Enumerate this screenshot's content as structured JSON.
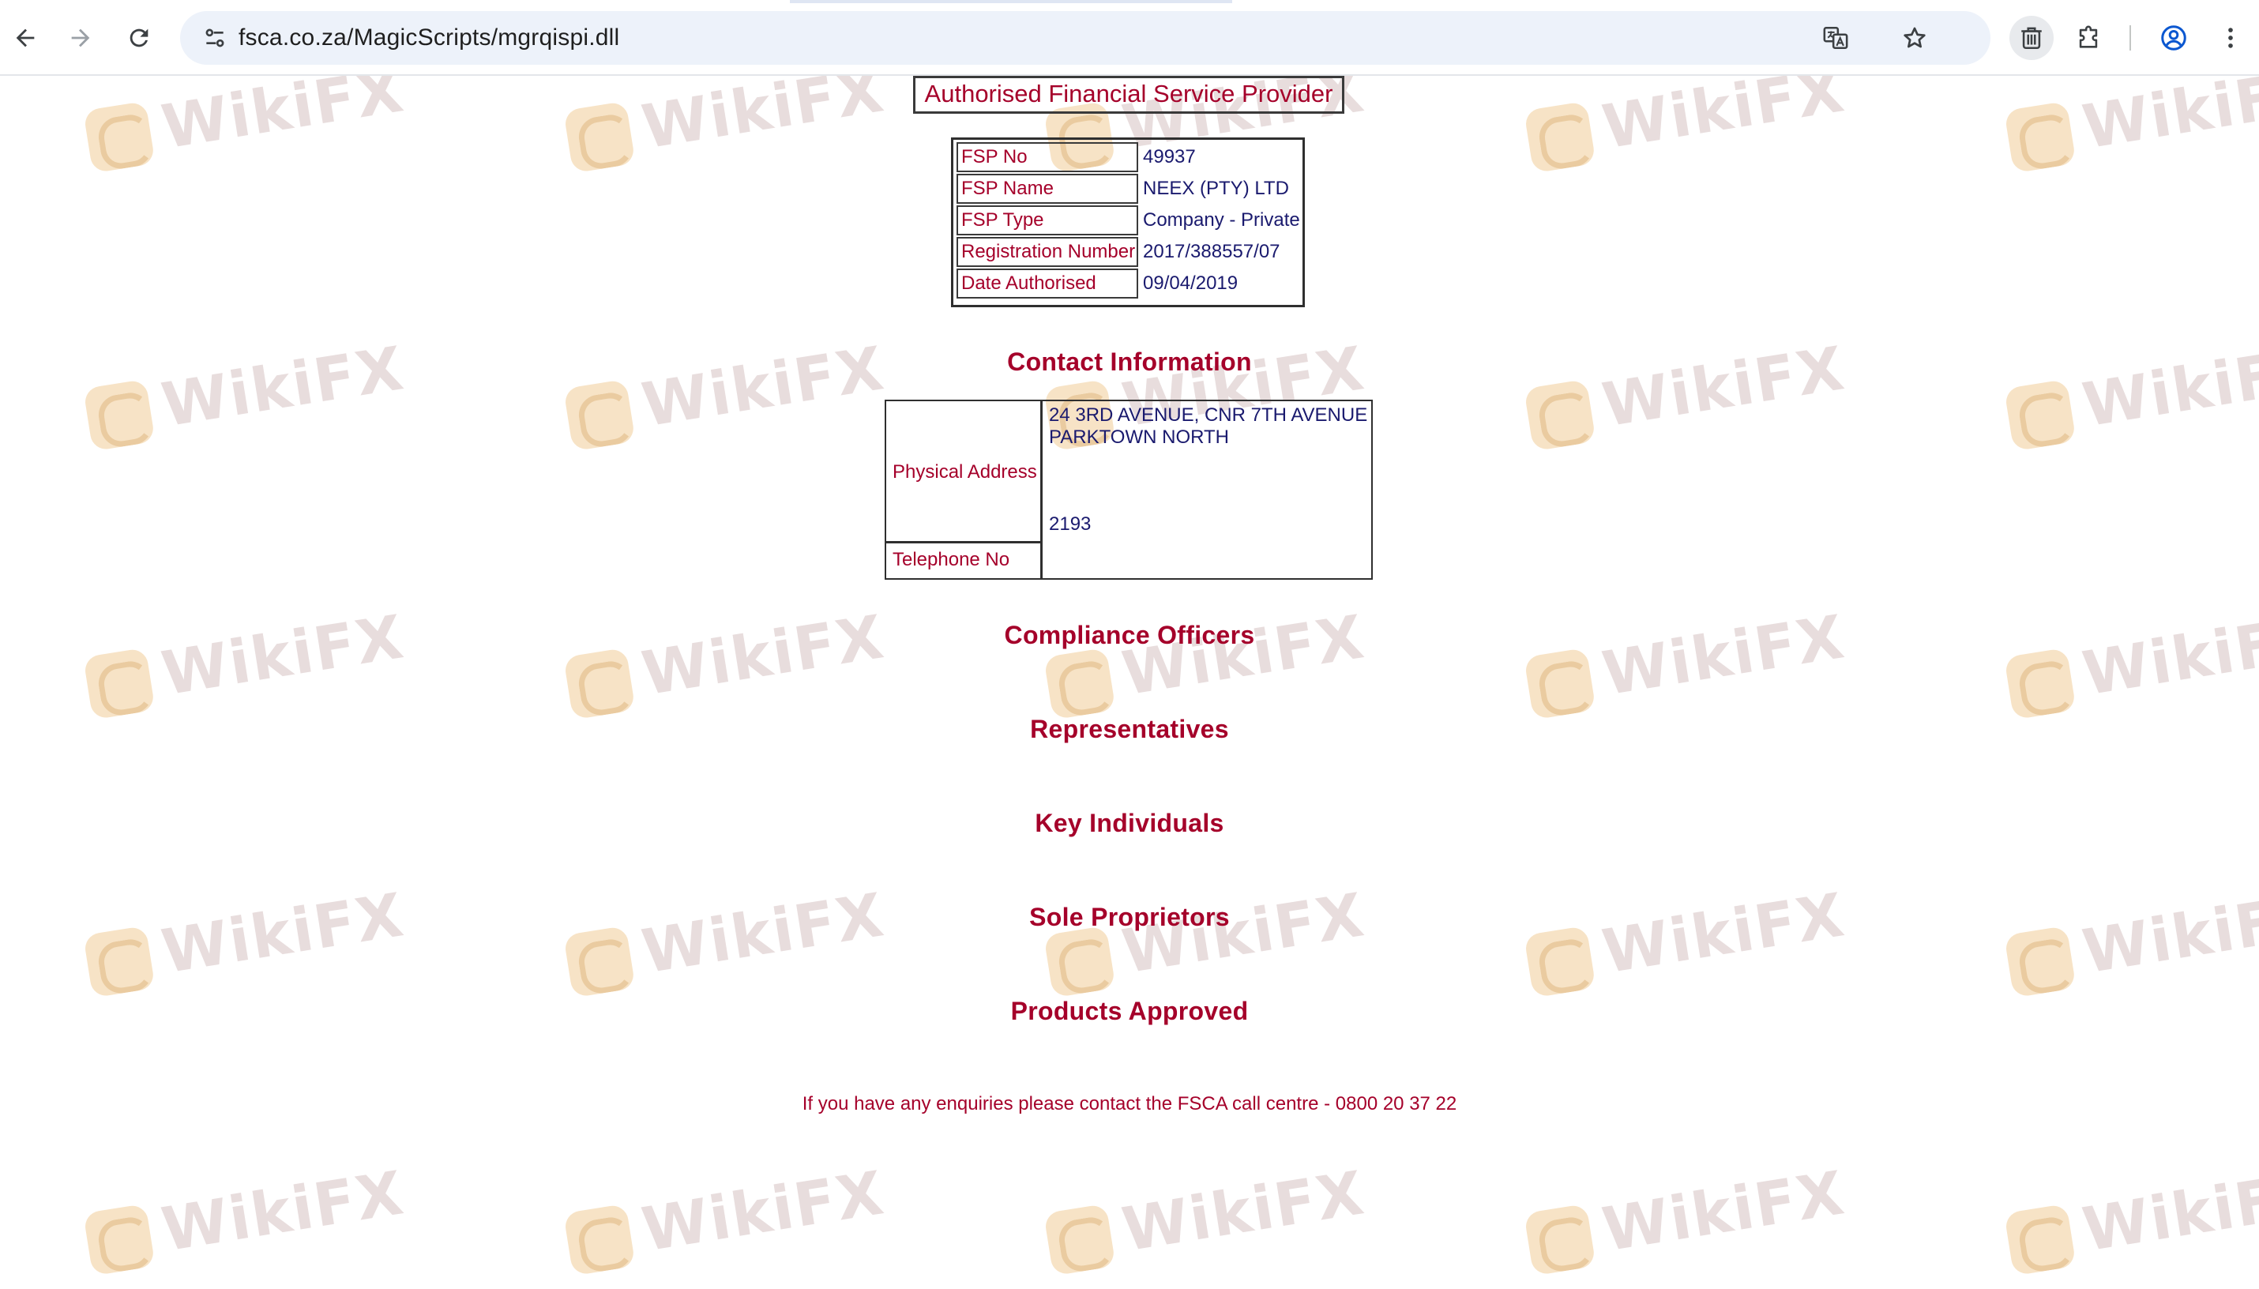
{
  "browser": {
    "url": "fsca.co.za/MagicScripts/mgrqispi.dll",
    "icons": {
      "back": "back-arrow-icon",
      "forward": "forward-arrow-icon",
      "reload": "reload-icon",
      "site_info": "tune-icon",
      "translate": "translate-icon",
      "bookmark": "star-icon",
      "extension_1": "trash-can-icon",
      "extensions": "puzzle-icon",
      "profile": "profile-icon",
      "menu": "kebab-menu-icon"
    }
  },
  "watermark": {
    "text": "WikiFX"
  },
  "fsp": {
    "title": "Authorised Financial Service Provider",
    "rows": [
      {
        "label": "FSP No",
        "value": "49937"
      },
      {
        "label": "FSP Name",
        "value": "NEEX (PTY) LTD"
      },
      {
        "label": "FSP Type",
        "value": "Company - Private"
      },
      {
        "label": "Registration Number",
        "value": "2017/388557/07"
      },
      {
        "label": "Date Authorised",
        "value": "09/04/2019"
      }
    ]
  },
  "contact": {
    "heading": "Contact Information",
    "physical_address_label": "Physical Address",
    "address_line_1": "24 3RD AVENUE, CNR 7TH AVENUE",
    "address_line_2": "PARKTOWN NORTH",
    "postcode": "2193",
    "telephone_label": "Telephone No"
  },
  "sections": {
    "compliance_officers": "Compliance Officers",
    "representatives": "Representatives",
    "key_individuals": "Key Individuals",
    "sole_proprietors": "Sole Proprietors",
    "products_approved": "Products Approved"
  },
  "footer": {
    "note": "If you have any enquiries please contact the FSCA call centre - 0800 20 37 22"
  },
  "colors": {
    "label_red": "#a5002a",
    "value_navy": "#1a1a6e",
    "omnibox_bg": "#edf2fa",
    "watermark_text": "#e7dcdc",
    "watermark_logo": "#f7e2c3"
  }
}
